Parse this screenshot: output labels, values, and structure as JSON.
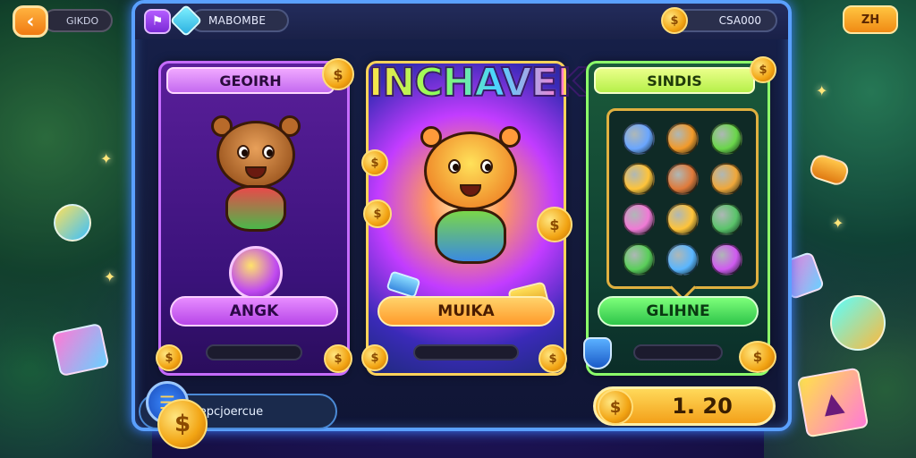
{
  "top_bar": {
    "back_glyph": "‹",
    "left_pill_text": "GIKDO",
    "right_button_label": "ZH"
  },
  "header": {
    "profile_icon_glyph": "⚑",
    "player_name": "MABOMBE",
    "coin_glyph": "$",
    "coin_balance": "CSA000"
  },
  "cards": {
    "left": {
      "title": "GEOIRH",
      "button_label": "ANGK"
    },
    "middle": {
      "title": "INCHAVEK",
      "button_label": "MUIKA"
    },
    "right": {
      "title": "SINDIS",
      "button_label": "GLIHNE"
    }
  },
  "items_grid": [
    {
      "icon": "blue-creature-icon",
      "color": "#6aa6ff"
    },
    {
      "icon": "leaf-gem-icon",
      "color": "#f29a2a"
    },
    {
      "icon": "green-creature-icon",
      "color": "#6ad64a"
    },
    {
      "icon": "cheese-block-icon",
      "color": "#ffc43a"
    },
    {
      "icon": "tiger-face-icon",
      "color": "#e07a3a"
    },
    {
      "icon": "flower-icon",
      "color": "#f0a83a"
    },
    {
      "icon": "pink-creature-icon",
      "color": "#f07ad6"
    },
    {
      "icon": "gold-shield-icon",
      "color": "#ffc43a"
    },
    {
      "icon": "green-turtle-icon",
      "color": "#5ac46a"
    },
    {
      "icon": "bush-icon",
      "color": "#5acf5a"
    },
    {
      "icon": "blue-crystal-icon",
      "color": "#5ab6ff"
    },
    {
      "icon": "purple-creature-icon",
      "color": "#d05af0"
    }
  ],
  "bottom": {
    "info_text": "yepcjoercue",
    "coin_glyph": "$",
    "total_value": "1. 20"
  },
  "colors": {
    "frame_border": "#5aa0ff",
    "left_card": "#c66cff",
    "middle_card": "#ffd35a",
    "right_card": "#8cff6a"
  }
}
